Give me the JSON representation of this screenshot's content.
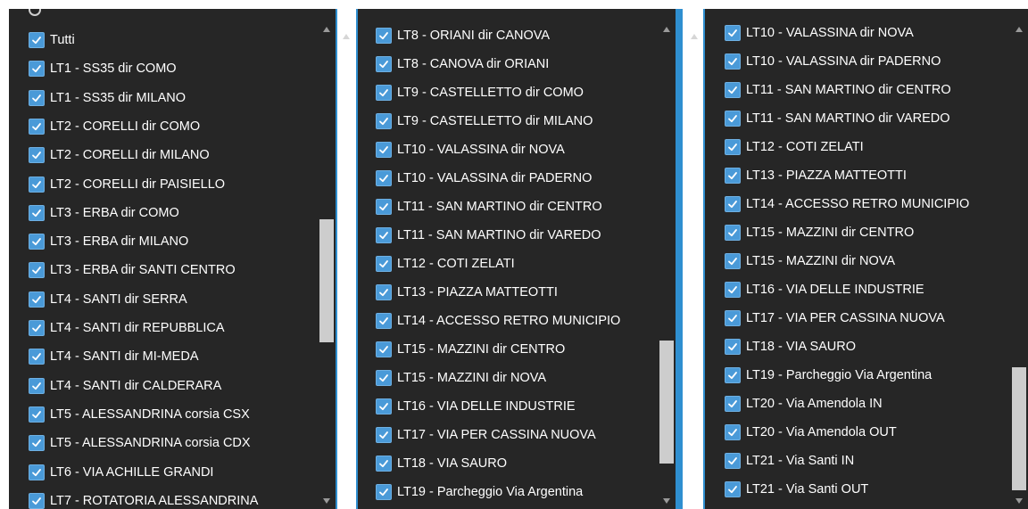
{
  "panels": [
    {
      "items": [
        "Tutti",
        "LT1 - SS35 dir COMO",
        "LT1 - SS35 dir MILANO",
        "LT2 - CORELLI dir COMO",
        "LT2 - CORELLI dir MILANO",
        "LT2 - CORELLI dir PAISIELLO",
        "LT3 - ERBA dir COMO",
        "LT3 - ERBA dir MILANO",
        "LT3 - ERBA dir SANTI CENTRO",
        "LT4 - SANTI dir SERRA",
        "LT4 - SANTI dir REPUBBLICA",
        "LT4 - SANTI dir MI-MEDA",
        "LT4 - SANTI dir CALDERARA",
        "LT5 - ALESSANDRINA corsia CSX",
        "LT5 - ALESSANDRINA corsia CDX",
        "LT6 - VIA ACHILLE GRANDI",
        "LT7 - ROTATORIA ALESSANDRINA"
      ]
    },
    {
      "items": [
        "LT8 - ORIANI dir CANOVA",
        "LT8 - CANOVA dir ORIANI",
        "LT9 - CASTELLETTO dir COMO",
        "LT9 - CASTELLETTO dir MILANO",
        "LT10 - VALASSINA dir NOVA",
        "LT10 - VALASSINA dir PADERNO",
        "LT11 - SAN MARTINO dir CENTRO",
        "LT11 - SAN MARTINO dir VAREDO",
        "LT12 - COTI ZELATI",
        "LT13 - PIAZZA MATTEOTTI",
        "LT14 - ACCESSO RETRO MUNICIPIO",
        "LT15 - MAZZINI dir CENTRO",
        "LT15 - MAZZINI dir NOVA",
        "LT16 - VIA DELLE INDUSTRIE",
        "LT17 - VIA PER CASSINA NUOVA",
        "LT18 - VIA SAURO",
        "LT19 - Parcheggio Via Argentina"
      ]
    },
    {
      "items": [
        "LT10 - VALASSINA dir NOVA",
        "LT10 - VALASSINA dir PADERNO",
        "LT11 - SAN MARTINO dir CENTRO",
        "LT11 - SAN MARTINO dir VAREDO",
        "LT12 - COTI ZELATI",
        "LT13 - PIAZZA MATTEOTTI",
        "LT14 - ACCESSO RETRO MUNICIPIO",
        "LT15 - MAZZINI dir CENTRO",
        "LT15 - MAZZINI dir NOVA",
        "LT16 - VIA DELLE INDUSTRIE",
        "LT17 - VIA PER CASSINA NUOVA",
        "LT18 - VIA SAURO",
        "LT19 - Parcheggio Via Argentina",
        "LT20 - Via Amendola IN",
        "LT20 - Via Amendola OUT",
        "LT21 - Via Santi IN",
        "LT21 - Via Santi OUT"
      ]
    }
  ],
  "colors": {
    "panel_bg": "#262626",
    "accent": "#2f8fd0",
    "checkbox": "#4a9ad8",
    "text": "#ffffff",
    "scroll_thumb": "#cdcdcd"
  },
  "icons": {
    "checkbox": "checkmark-icon",
    "scroll_up": "triangle-up-icon",
    "scroll_down": "triangle-down-icon"
  }
}
